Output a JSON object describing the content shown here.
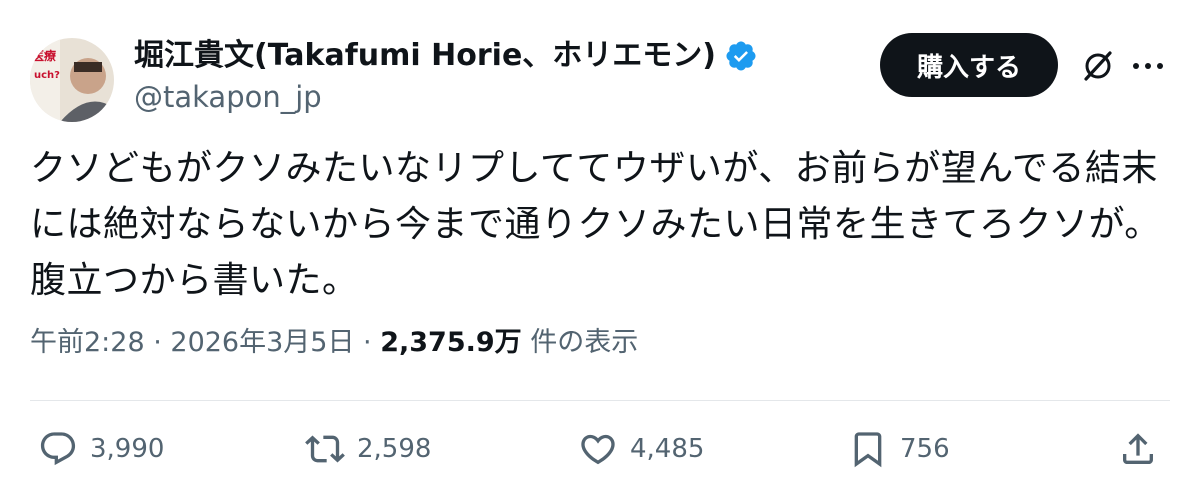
{
  "author": {
    "display_name": "堀江貴文(Takafumi Horie、ホリエモン)",
    "handle": "@takapon_jp",
    "verified": true,
    "verified_color": "#1d9bf0",
    "avatar_text": "医療",
    "avatar_text2": "uch?"
  },
  "header": {
    "buy_label": "購入する",
    "icons": [
      "grok-icon",
      "more-icon"
    ]
  },
  "tweet": {
    "text": "クソどもがクソみたいなリプしててウザいが、お前らが望んでる結末には絶対ならないから今まで通りクソみたい日常を生きてろクソが。腹立つから書いた。"
  },
  "meta": {
    "time": "午前2:28",
    "sep1": " · ",
    "date": "2026年3月5日",
    "sep2": " · ",
    "views_count": "2,375.9万",
    "views_label": " 件の表示"
  },
  "actions": {
    "replies": "3,990",
    "retweets": "2,598",
    "likes": "4,485",
    "bookmarks": "756"
  },
  "colors": {
    "text": "#0f1419",
    "secondary": "#536471",
    "button_bg": "#0f1419",
    "divider": "#e4e7ea"
  }
}
